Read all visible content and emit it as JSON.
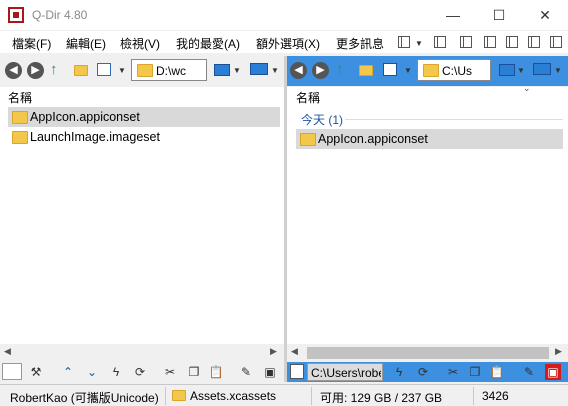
{
  "window": {
    "title": "Q-Dir 4.80",
    "minimize": "—",
    "maximize": "☐",
    "close": "✕"
  },
  "menu": [
    "檔案(F)",
    "編輯(E)",
    "檢視(V)",
    "我的最愛(A)",
    "額外選項(X)",
    "更多訊息"
  ],
  "left_pane": {
    "address": "D:\\wc",
    "column_header": "名稱",
    "items": [
      {
        "name": "AppIcon.appiconset",
        "selected": true
      },
      {
        "name": "LaunchImage.imageset",
        "selected": false
      }
    ]
  },
  "right_pane": {
    "address": "C:\\Us",
    "column_header": "名稱",
    "group_label": "今天 (1)",
    "items": [
      {
        "name": "AppIcon.appiconset",
        "selected": true
      }
    ],
    "bottom_path": "C:\\Users\\robe"
  },
  "status": {
    "user": "RobertKao (可攜版Unicode)",
    "folder": "Assets.xcassets",
    "space": "可用: 129 GB / 237 GB",
    "count": "3426"
  },
  "colors": {
    "accent_blue": "#3d8fe0",
    "selection": "#d9d9d9",
    "folder": "#f3c749",
    "app_red": "#a81818"
  }
}
